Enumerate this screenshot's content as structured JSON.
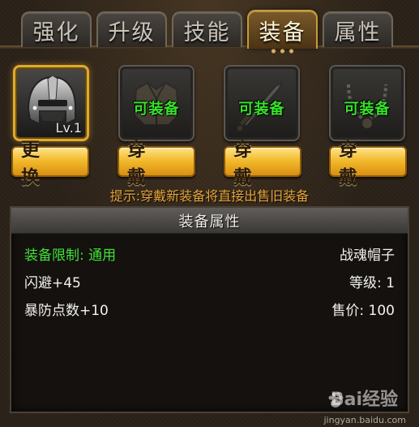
{
  "tabs": [
    {
      "label": "强化",
      "active": false
    },
    {
      "label": "升级",
      "active": false
    },
    {
      "label": "技能",
      "active": false
    },
    {
      "label": "装备",
      "active": true
    },
    {
      "label": "属性",
      "active": false
    }
  ],
  "slots": [
    {
      "kind": "helmet",
      "level_label": "Lv.1",
      "button_label": "更 换",
      "equipped": true
    },
    {
      "kind": "armor",
      "status_label": "可装备",
      "button_label": "穿 戴",
      "equipped": false
    },
    {
      "kind": "weapon",
      "status_label": "可装备",
      "button_label": "穿 戴",
      "equipped": false
    },
    {
      "kind": "necklace",
      "status_label": "可装备",
      "button_label": "穿 戴",
      "equipped": false
    }
  ],
  "hint": "提示:穿戴新装备将直接出售旧装备",
  "panel": {
    "title": "装备属性",
    "restriction": "装备限制: 通用",
    "item_name": "战魂帽子",
    "stat_line": "闪避+45",
    "level": "等级: 1",
    "stat_line_2": "暴防点数+10",
    "price": "售价: 100"
  },
  "watermark": {
    "brand": "Bai经验",
    "url": "jingyan.baidu.com"
  },
  "colors": {
    "equipable_green": "#37e22a",
    "hint_orange": "#e8a53a",
    "gold_button": "#f3bb2e",
    "active_tab_border": "#c79a3a"
  }
}
